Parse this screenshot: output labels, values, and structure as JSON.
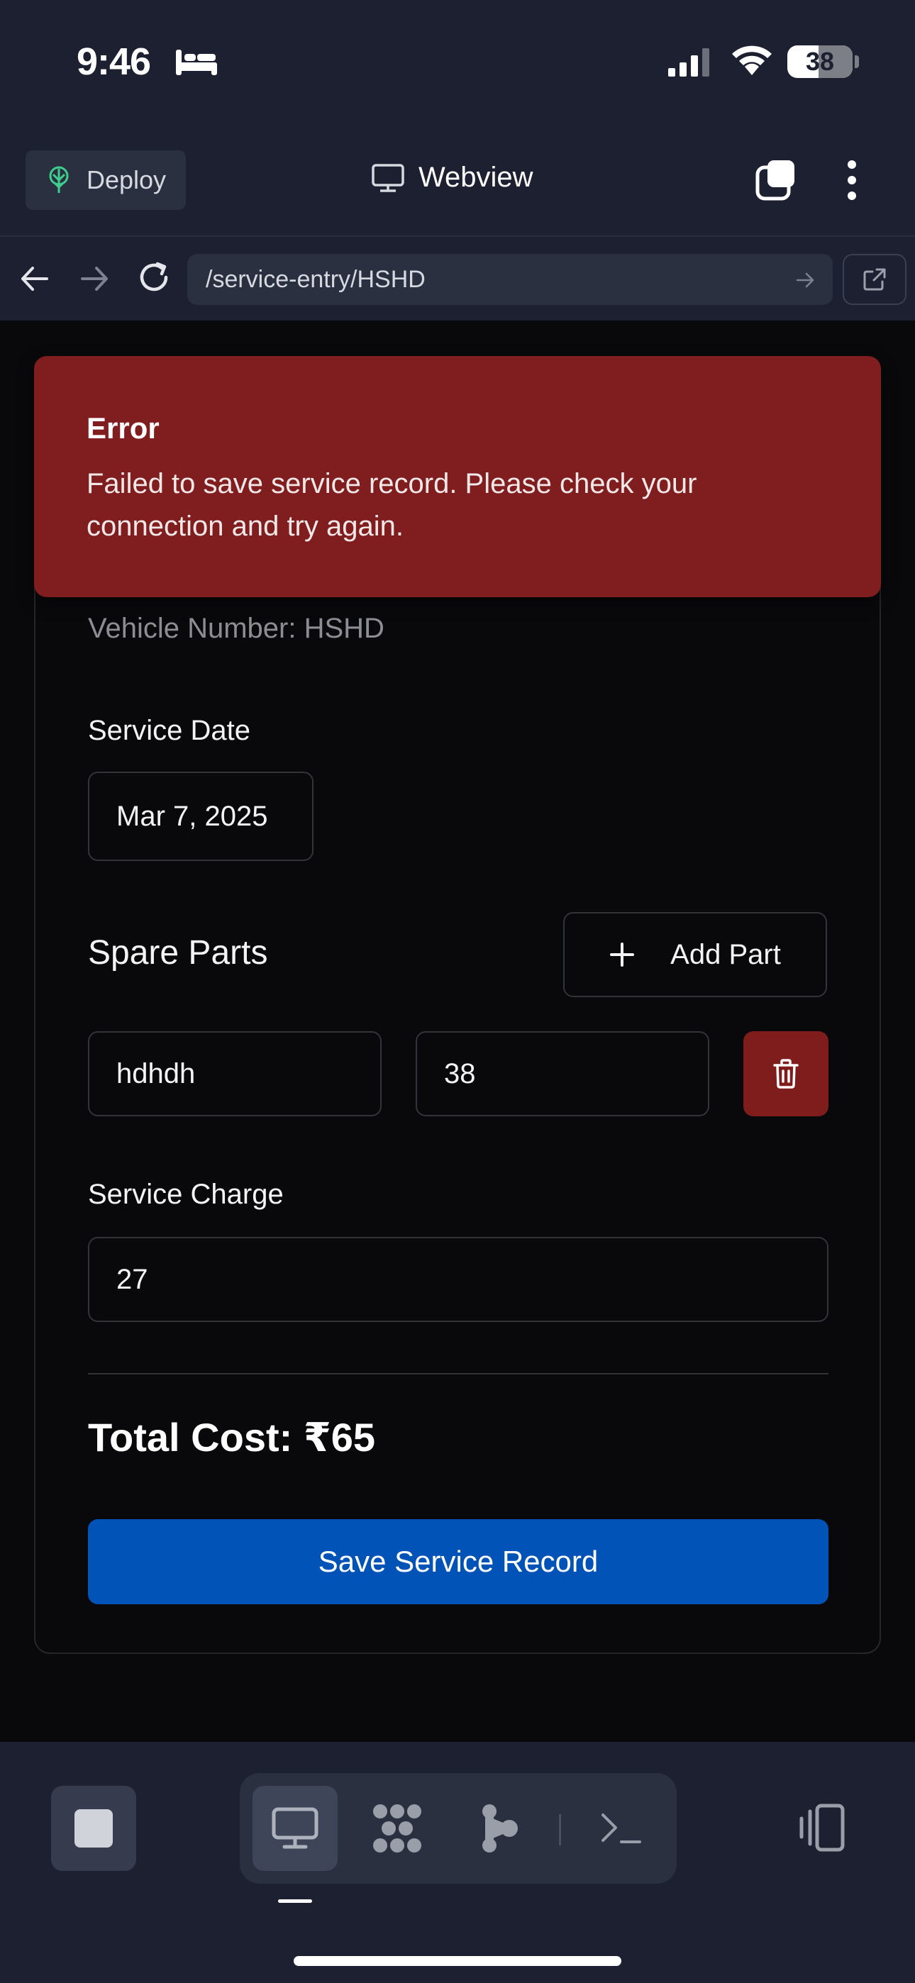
{
  "status_bar": {
    "time": "9:46",
    "battery": "38",
    "icons": [
      "bed-icon",
      "signal-icon",
      "wifi-icon",
      "battery-icon"
    ]
  },
  "app_header": {
    "deploy_label": "Deploy",
    "title": "Webview",
    "icons": [
      "deploy-icon",
      "monitor-icon",
      "tabs-icon",
      "more-vertical-icon"
    ]
  },
  "url_bar": {
    "url": "/service-entry/HSHD",
    "icons": [
      "back-arrow-icon",
      "forward-arrow-icon",
      "reload-icon",
      "go-arrow-icon",
      "external-link-icon"
    ]
  },
  "error": {
    "title": "Error",
    "message": "Failed to save service record. Please check your connection and try again."
  },
  "form": {
    "vehicle_number": "Vehicle Number: HSHD",
    "service_date_label": "Service Date",
    "service_date_value": "Mar 7, 2025",
    "spare_parts_title": "Spare Parts",
    "add_part_label": "Add Part",
    "parts": [
      {
        "name": "hdhdh",
        "cost": "38"
      }
    ],
    "service_charge_label": "Service Charge",
    "service_charge_value": "27",
    "total_cost": "Total Cost: ₹65",
    "save_label": "Save Service Record"
  },
  "bottom_toolbar": {
    "icons": [
      "stop-icon",
      "monitor-icon",
      "apps-grid-icon",
      "graph-icon",
      "terminal-icon",
      "device-rotate-icon"
    ],
    "active_tab": "monitor-icon"
  },
  "colors": {
    "background": "#09090b",
    "chrome": "#1c2030",
    "error": "#7f1d1f",
    "primary": "#0253b8",
    "danger": "#7f1d1d"
  }
}
